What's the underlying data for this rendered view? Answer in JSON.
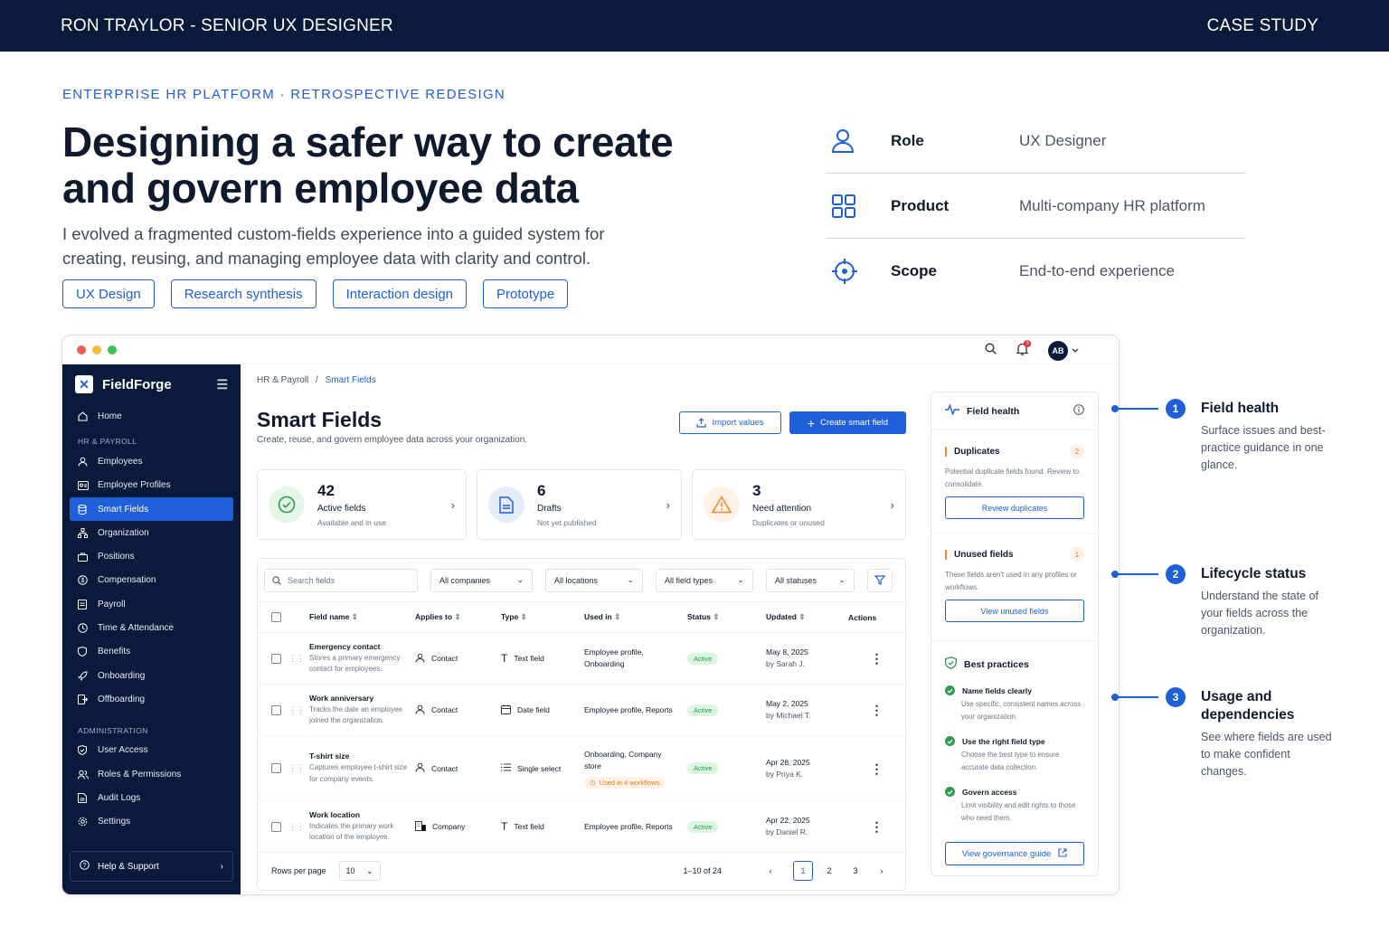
{
  "topbar": {
    "left": "RON TRAYLOR - SENIOR UX DESIGNER",
    "right": "CASE STUDY"
  },
  "hero": {
    "eyebrow": "ENTERPRISE HR PLATFORM · RETROSPECTIVE REDESIGN",
    "title": "Designing a safer way to create and govern employee data",
    "intro": "I evolved a fragmented custom-fields experience into a guided system for creating, reusing, and managing employee data with clarity and control.",
    "tags": [
      "UX Design",
      "Research synthesis",
      "Interaction design",
      "Prototype"
    ]
  },
  "meta": [
    {
      "icon": "user-icon",
      "label": "Role",
      "value": "UX Designer"
    },
    {
      "icon": "grid-icon",
      "label": "Product",
      "value": "Multi-company HR platform"
    },
    {
      "icon": "target-icon",
      "label": "Scope",
      "value": "End-to-end experience"
    }
  ],
  "window": {
    "avatar": "AB",
    "notification_count": "3"
  },
  "sidebar": {
    "brand": "FieldForge",
    "home": "Home",
    "section1": "HR & PAYROLL",
    "items1": [
      "Employees",
      "Employee Profiles",
      "Smart Fields",
      "Organization",
      "Positions",
      "Compensation",
      "Payroll",
      "Time & Attendance",
      "Benefits",
      "Onboarding",
      "Offboarding"
    ],
    "section2": "ADMINISTRATION",
    "items2": [
      "User Access",
      "Roles & Permissions",
      "Audit Logs",
      "Settings"
    ],
    "help": "Help & Support"
  },
  "main": {
    "crumb_parent": "HR & Payroll",
    "crumb_sep": "/",
    "crumb_current": "Smart Fields",
    "title": "Smart Fields",
    "subtitle": "Create, reuse, and govern employee data across your organization.",
    "import_btn": "Import values",
    "create_btn": "Create smart field",
    "stats": [
      {
        "num": "42",
        "label": "Active fields",
        "sub": "Available and in use"
      },
      {
        "num": "6",
        "label": "Drafts",
        "sub": "Not yet published"
      },
      {
        "num": "3",
        "label": "Need attention",
        "sub": "Duplicates or unused"
      }
    ],
    "search_placeholder": "Search fields",
    "filters": [
      "All companies",
      "All locations",
      "All field types",
      "All statuses"
    ],
    "columns": [
      "Field name",
      "Applies to",
      "Type",
      "Used in",
      "Status",
      "Updated",
      "Actions"
    ],
    "rows": [
      {
        "name": "Emergency contact",
        "desc": "Stores a primary emergency contact for employees.",
        "applies": "Contact",
        "type": "Text field",
        "used": "Employee profile, Onboarding",
        "status": "Active",
        "date": "May 8, 2025",
        "by": "by Sarah J."
      },
      {
        "name": "Work anniversary",
        "desc": "Tracks the date an employee joined the organization.",
        "applies": "Contact",
        "type": "Date field",
        "used": "Employee profile, Reports",
        "status": "Active",
        "date": "May 2, 2025",
        "by": "by Michael T."
      },
      {
        "name": "T-shirt size",
        "desc": "Captures employee t-shirt size for company events.",
        "applies": "Contact",
        "type": "Single select",
        "used": "Onboarding, Company store",
        "workflow": "Used in 4 workflows",
        "status": "Active",
        "date": "Apr 28, 2025",
        "by": "by Priya K."
      },
      {
        "name": "Work location",
        "desc": "Indicates the primary work location of the employee.",
        "applies": "Company",
        "type": "Text field",
        "used": "Employee profile, Reports",
        "status": "Active",
        "date": "Apr 22, 2025",
        "by": "by Daniel R."
      }
    ],
    "rows_per_page_label": "Rows per page",
    "rows_per_page": "10",
    "range": "1–10 of 24",
    "pages": [
      "1",
      "2",
      "3"
    ]
  },
  "health": {
    "title": "Field health",
    "dup_title": "Duplicates",
    "dup_count": "2",
    "dup_desc": "Potential duplicate fields found. Review to consolidate.",
    "dup_btn": "Review duplicates",
    "unused_title": "Unused fields",
    "unused_count": "1",
    "unused_desc": "These fields aren't used in any profiles or workflows.",
    "unused_btn": "View unused fields",
    "bp_title": "Best practices",
    "practices": [
      {
        "title": "Name fields clearly",
        "desc": "Use specific, consistent names across your organization."
      },
      {
        "title": "Use the right field type",
        "desc": "Choose the best type to ensure accurate data collection."
      },
      {
        "title": "Govern access",
        "desc": "Limit visibility and edit rights to those who need them."
      }
    ],
    "gov_btn": "View governance guide"
  },
  "annotations": [
    {
      "num": "1",
      "title": "Field health",
      "desc": "Surface issues and best-practice guidance in one glance."
    },
    {
      "num": "2",
      "title": "Lifecycle status",
      "desc": "Understand the state of your fields across the organization."
    },
    {
      "num": "3",
      "title": "Usage and dependencies",
      "desc": "See where fields are used to make confident changes."
    }
  ],
  "colors": {
    "navy": "#0a1a3a",
    "accent": "#1f5fd9",
    "success": "#2d9a4f",
    "warning": "#f08c2e"
  }
}
